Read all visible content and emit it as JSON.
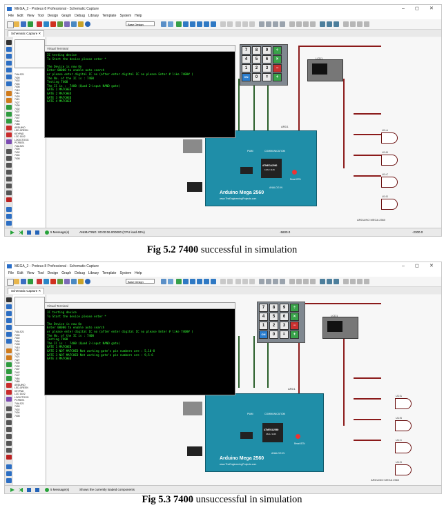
{
  "figures": [
    {
      "window_title": "MEGA_2 - Proteus 8 Professional - Schematic Capture",
      "menu": [
        "File",
        "Edit",
        "View",
        "Tool",
        "Design",
        "Graph",
        "Debug",
        "Library",
        "Template",
        "System",
        "Help"
      ],
      "design_combo": "Base Design",
      "tab": "Schematic Capture",
      "terminal_title": "Virtual Terminal",
      "terminal_lines": [
        "IC testing device",
        "To Start the device please enter *",
        "",
        "The Device is now On",
        "Enter 00000 to enable auto search",
        "or please enter digital IC no (after enter digital IC no please Enter # like 7400# )",
        "The No. of the IC is : 7400",
        "Testing 7400",
        "The IC is :  7400 (Quad 2-input NAND gate)",
        "GATE 1 MATCHED",
        "GATE 2 MATCHED",
        "GATE 3 MATCHED",
        "GATE 4 MATCHED"
      ],
      "status_messages": "5 Message(s)",
      "status_text": "ANIMATING: 00:00:06.000000 (CPU load 40%)",
      "status_coord_a": "-5600.0",
      "status_coord_b": "-2300.0",
      "caption_bold": "Fig 5.2 7400",
      "caption_rest": " successful in simulation"
    },
    {
      "window_title": "MEGA_2 - Proteus 8 Professional - Schematic Capture",
      "menu": [
        "File",
        "Edit",
        "View",
        "Tool",
        "Design",
        "Graph",
        "Debug",
        "Library",
        "Template",
        "System",
        "Help"
      ],
      "design_combo": "Base Design",
      "tab": "Schematic Capture",
      "terminal_title": "Virtual Terminal",
      "terminal_lines": [
        "IC testing device",
        "To Start the device please enter *",
        "",
        "The Device is now On",
        "Enter 00000 to enable auto search",
        "or please enter digital IC no (after enter digital IC no please Enter # like 7400# )",
        "The No. of the IC is : 7400",
        "Testing 7400",
        "The IC is :  7400 (Quad 2-input NAND gate)",
        "GATE 1 MATCHED",
        "GATE 2 NOT MATCHED Not working gate's pin numbers are : 5,10-8",
        "GATE 3 NOT MATCHED Not working gate's pin numbers are : 9,5-6",
        "GATE 4 MATCHED"
      ],
      "status_messages": "5 Message(s)",
      "status_text": "Shows the currently loaded components",
      "status_coord_a": "",
      "status_coord_b": "",
      "caption_bold": "Fig 5.3 7400",
      "caption_rest": " unsuccessful in simulation"
    }
  ],
  "keypad_keys": [
    "7",
    "8",
    "9",
    "÷",
    "4",
    "5",
    "6",
    "×",
    "1",
    "2",
    "3",
    "−",
    "ON",
    "0",
    "=",
    "+"
  ],
  "device_list": [
    "74ALS21",
    "7400",
    "7402",
    "7404",
    "7408",
    "7410",
    "7411",
    "7420",
    "7421",
    "7427",
    "7430",
    "7432",
    "7437",
    "7442",
    "7447",
    "7454",
    "7486",
    "ARDUINO",
    "LED-GREEN",
    "KEYPAD",
    "LCD 16X2",
    "LOGICTOGG",
    "PCF8574",
    "74ALS21",
    "7400",
    "7402",
    "7404",
    "7408"
  ],
  "board": {
    "name": "Arduino Mega 2560",
    "url": "www.TheEngineeringProjects.com",
    "chip_label": "ATMEGA2560",
    "chip_sub": "16AU 1126",
    "pwm": "PWM",
    "comm": "COMMUNICATION",
    "analog": "ANALOG IN",
    "reset": "Reset BTN",
    "ref": "ARD1"
  },
  "gates": [
    "U1:A",
    "U1:B",
    "U1:C",
    "U1:D"
  ],
  "lcd_ref": "LCD1",
  "footer_ref": "ARDUINO MEGA 2560"
}
